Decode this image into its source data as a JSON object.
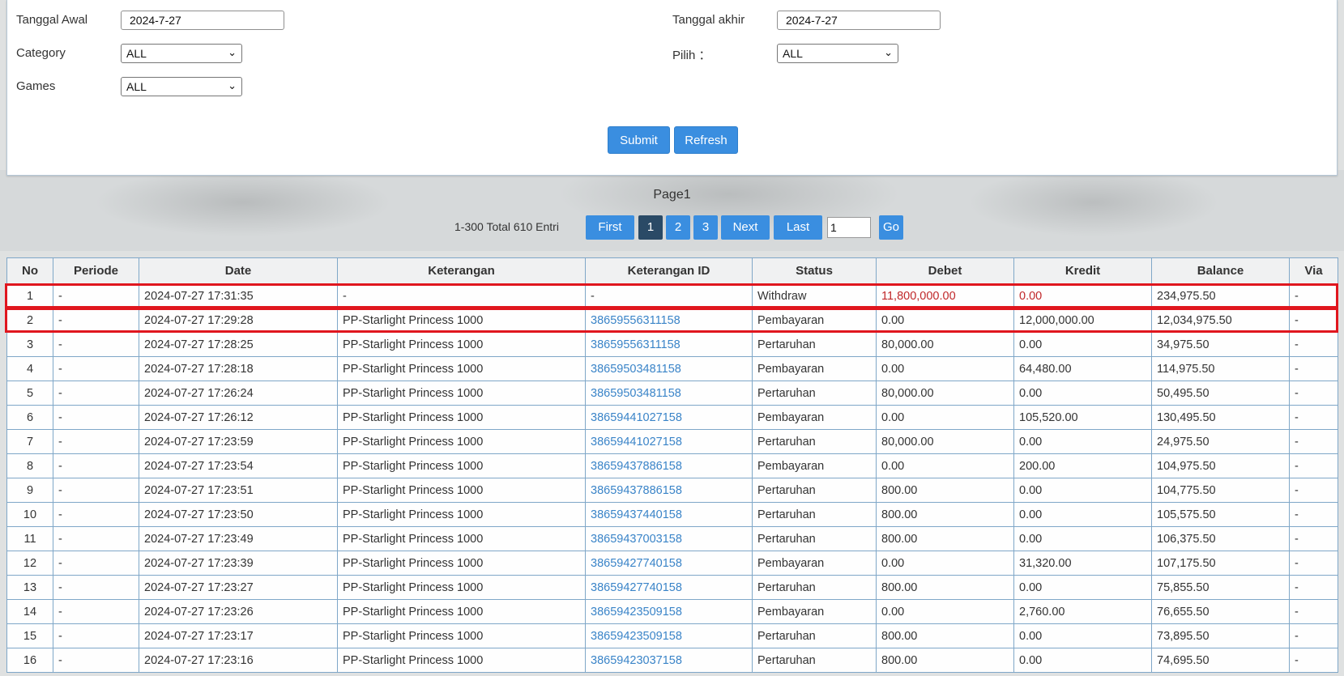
{
  "filters": {
    "tanggal_awal_label": "Tanggal Awal",
    "tanggal_awal_value": "2024-7-27",
    "tanggal_akhir_label": "Tanggal akhir",
    "tanggal_akhir_value": "2024-7-27",
    "category_label": "Category",
    "category_value": "ALL",
    "pilih_label": "Pilih ：",
    "pilih_value": "ALL",
    "games_label": "Games",
    "games_value": "ALL",
    "submit_label": "Submit",
    "refresh_label": "Refresh"
  },
  "pager": {
    "title": "Page1",
    "summary": "1-300 Total 610 Entri",
    "first": "First",
    "pages": [
      "1",
      "2",
      "3"
    ],
    "active_page": "1",
    "next": "Next",
    "last": "Last",
    "page_input": "1",
    "go": "Go"
  },
  "table": {
    "headers": [
      "No",
      "Periode",
      "Date",
      "Keterangan",
      "Keterangan ID",
      "Status",
      "Debet",
      "Kredit",
      "Balance",
      "Via"
    ],
    "rows": [
      [
        "1",
        "-",
        "2024-07-27 17:31:35",
        "-",
        "-",
        "Withdraw",
        "11,800,000.00",
        "0.00",
        "234,975.50",
        "-"
      ],
      [
        "2",
        "-",
        "2024-07-27 17:29:28",
        "PP-Starlight Princess 1000",
        "38659556311158",
        "Pembayaran",
        "0.00",
        "12,000,000.00",
        "12,034,975.50",
        "-"
      ],
      [
        "3",
        "-",
        "2024-07-27 17:28:25",
        "PP-Starlight Princess 1000",
        "38659556311158",
        "Pertaruhan",
        "80,000.00",
        "0.00",
        "34,975.50",
        "-"
      ],
      [
        "4",
        "-",
        "2024-07-27 17:28:18",
        "PP-Starlight Princess 1000",
        "38659503481158",
        "Pembayaran",
        "0.00",
        "64,480.00",
        "114,975.50",
        "-"
      ],
      [
        "5",
        "-",
        "2024-07-27 17:26:24",
        "PP-Starlight Princess 1000",
        "38659503481158",
        "Pertaruhan",
        "80,000.00",
        "0.00",
        "50,495.50",
        "-"
      ],
      [
        "6",
        "-",
        "2024-07-27 17:26:12",
        "PP-Starlight Princess 1000",
        "38659441027158",
        "Pembayaran",
        "0.00",
        "105,520.00",
        "130,495.50",
        "-"
      ],
      [
        "7",
        "-",
        "2024-07-27 17:23:59",
        "PP-Starlight Princess 1000",
        "38659441027158",
        "Pertaruhan",
        "80,000.00",
        "0.00",
        "24,975.50",
        "-"
      ],
      [
        "8",
        "-",
        "2024-07-27 17:23:54",
        "PP-Starlight Princess 1000",
        "38659437886158",
        "Pembayaran",
        "0.00",
        "200.00",
        "104,975.50",
        "-"
      ],
      [
        "9",
        "-",
        "2024-07-27 17:23:51",
        "PP-Starlight Princess 1000",
        "38659437886158",
        "Pertaruhan",
        "800.00",
        "0.00",
        "104,775.50",
        "-"
      ],
      [
        "10",
        "-",
        "2024-07-27 17:23:50",
        "PP-Starlight Princess 1000",
        "38659437440158",
        "Pertaruhan",
        "800.00",
        "0.00",
        "105,575.50",
        "-"
      ],
      [
        "11",
        "-",
        "2024-07-27 17:23:49",
        "PP-Starlight Princess 1000",
        "38659437003158",
        "Pertaruhan",
        "800.00",
        "0.00",
        "106,375.50",
        "-"
      ],
      [
        "12",
        "-",
        "2024-07-27 17:23:39",
        "PP-Starlight Princess 1000",
        "38659427740158",
        "Pembayaran",
        "0.00",
        "31,320.00",
        "107,175.50",
        "-"
      ],
      [
        "13",
        "-",
        "2024-07-27 17:23:27",
        "PP-Starlight Princess 1000",
        "38659427740158",
        "Pertaruhan",
        "800.00",
        "0.00",
        "75,855.50",
        "-"
      ],
      [
        "14",
        "-",
        "2024-07-27 17:23:26",
        "PP-Starlight Princess 1000",
        "38659423509158",
        "Pembayaran",
        "0.00",
        "2,760.00",
        "76,655.50",
        "-"
      ],
      [
        "15",
        "-",
        "2024-07-27 17:23:17",
        "PP-Starlight Princess 1000",
        "38659423509158",
        "Pertaruhan",
        "800.00",
        "0.00",
        "73,895.50",
        "-"
      ],
      [
        "16",
        "-",
        "2024-07-27 17:23:16",
        "PP-Starlight Princess 1000",
        "38659423037158",
        "Pertaruhan",
        "800.00",
        "0.00",
        "74,695.50",
        "-"
      ]
    ]
  },
  "colors": {
    "accent": "#3a8ee0",
    "active_page": "#2a4a66",
    "link": "#3a84c8",
    "negative": "#c0282a",
    "highlight_box": "#e0161e"
  }
}
